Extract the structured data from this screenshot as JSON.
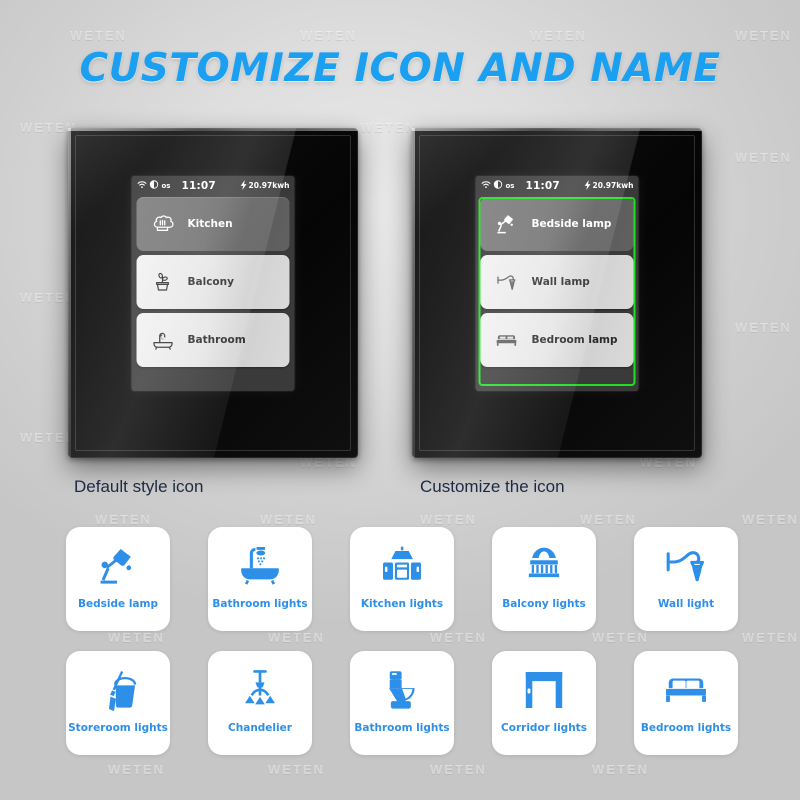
{
  "header": {
    "title": "CUSTOMIZE ICON AND NAME",
    "title_color": "#1b9ff0"
  },
  "watermark": {
    "text": "WETEN"
  },
  "panels": [
    {
      "caption": "Default style icon",
      "status_bar": {
        "wifi_icon": "wifi-icon",
        "os_icon": "os-circle-icon",
        "os_label": "os",
        "time": "11:07",
        "bolt_icon": "lightning-bolt-icon",
        "energy": "20.97kwh"
      },
      "highlighted": false,
      "buttons": [
        {
          "label": "Kitchen",
          "icon": "chef-hat-icon",
          "state": "on"
        },
        {
          "label": "Balcony",
          "icon": "potted-plant-icon",
          "state": "off"
        },
        {
          "label": "Bathroom",
          "icon": "bathtub-icon",
          "state": "off"
        }
      ]
    },
    {
      "caption": "Customize the icon",
      "status_bar": {
        "wifi_icon": "wifi-icon",
        "os_icon": "os-circle-icon",
        "os_label": "os",
        "time": "11:07",
        "bolt_icon": "lightning-bolt-icon",
        "energy": "20.97kwh"
      },
      "highlighted": true,
      "highlight_color": "#21e021",
      "buttons": [
        {
          "label": "Bedside lamp",
          "icon": "desk-lamp-icon",
          "state": "on"
        },
        {
          "label": "Wall lamp",
          "icon": "wall-lamp-icon",
          "state": "off"
        },
        {
          "label": "Bedroom lamp",
          "icon": "bed-icon",
          "state": "off"
        }
      ]
    }
  ],
  "icon_library": {
    "accent_color": "#2e8fe8",
    "items": [
      {
        "label": "Bedside lamp",
        "icon": "desk-lamp-icon"
      },
      {
        "label": "Bathroom lights",
        "icon": "bathtub-shower-icon"
      },
      {
        "label": "Kitchen lights",
        "icon": "kitchen-range-hood-icon"
      },
      {
        "label": "Balcony lights",
        "icon": "balcony-railing-icon"
      },
      {
        "label": "Wall light",
        "icon": "wall-sconce-icon"
      },
      {
        "label": "Storeroom lights",
        "icon": "mop-bucket-icon"
      },
      {
        "label": "Chandelier",
        "icon": "chandelier-icon"
      },
      {
        "label": "Bathroom lights",
        "icon": "toilet-icon"
      },
      {
        "label": "Corridor lights",
        "icon": "doorway-icon"
      },
      {
        "label": "Bedroom lights",
        "icon": "bed-icon"
      }
    ]
  }
}
